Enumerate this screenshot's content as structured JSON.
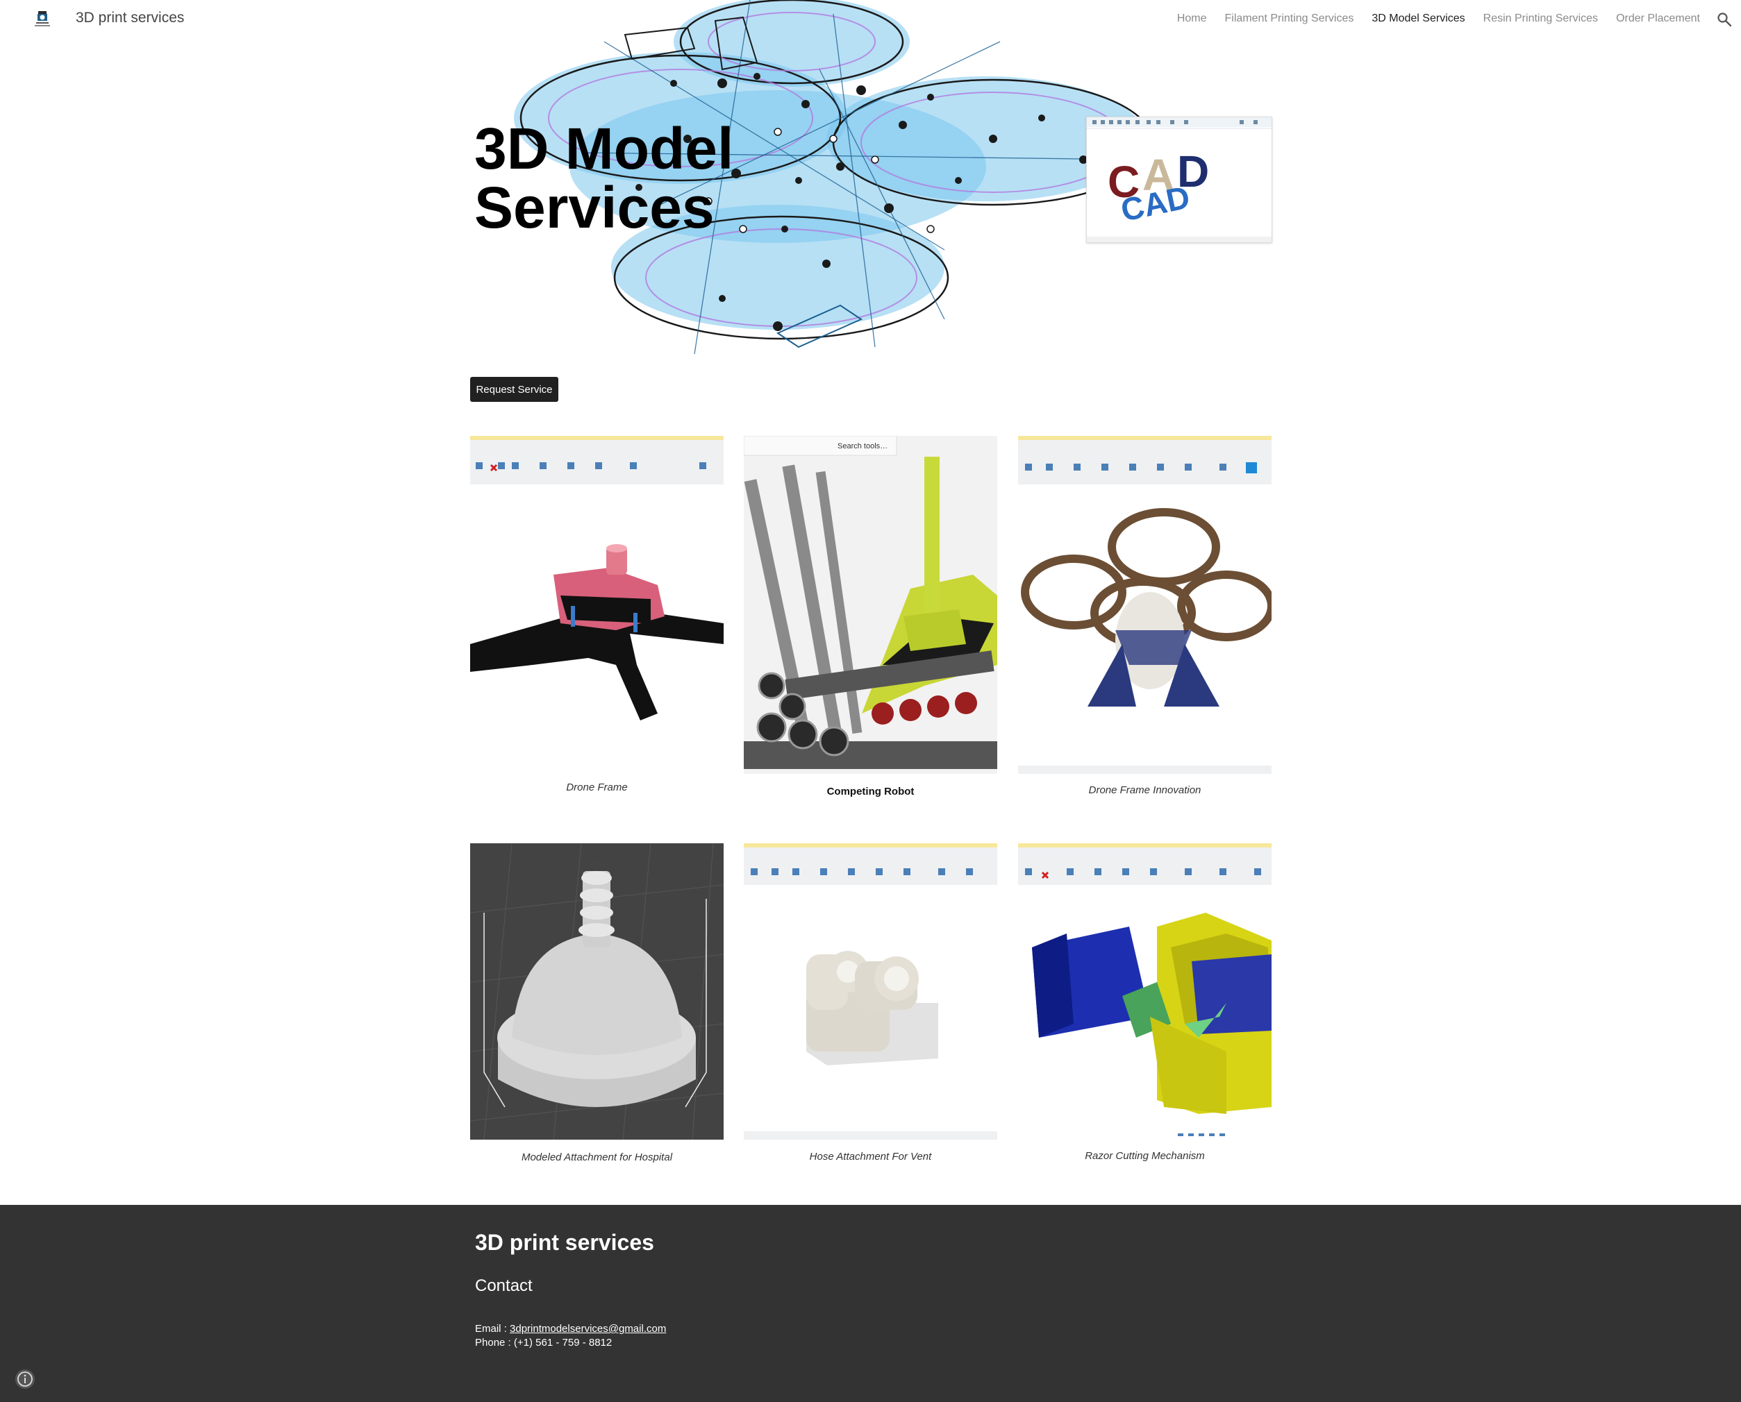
{
  "header": {
    "site_title": "3D print services",
    "logo_icon": "site-logo-icon",
    "nav": [
      {
        "label": "Home",
        "active": false
      },
      {
        "label": "Filament Printing Services",
        "active": false
      },
      {
        "label": "3D Model Services",
        "active": true
      },
      {
        "label": "Resin Printing Services",
        "active": false
      },
      {
        "label": "Order Placement",
        "active": false
      }
    ],
    "search_icon": "search-icon"
  },
  "hero": {
    "title_line1": "3D Model",
    "title_line2": "Services",
    "cad_text": "CAD"
  },
  "request_button": "Request Service",
  "gallery": [
    {
      "caption": "Drone Frame",
      "style": "italic"
    },
    {
      "caption": "Competing Robot",
      "style": "bold"
    },
    {
      "caption": "Drone Frame Innovation",
      "style": "italic"
    },
    {
      "caption": "Modeled Attachment for Hospital",
      "style": "italic"
    },
    {
      "caption": "Hose Attachment For Vent",
      "style": "italic"
    },
    {
      "caption": "Razor Cutting Mechanism",
      "style": "italic"
    }
  ],
  "footer": {
    "title": "3D print services",
    "contact_heading": "Contact",
    "email_label": "Email  :",
    "email": "3dprintmodelservices@gmail.com",
    "phone_label": "Phone :",
    "phone": "(+1) 561 - 759 - 8812",
    "info_icon": "info-icon"
  },
  "colors": {
    "footer_bg": "#333333",
    "button_bg": "#212121",
    "nav_active": "#202020",
    "nav_inactive": "#8a8a8a",
    "hero_blue": "#7cc7ec"
  }
}
